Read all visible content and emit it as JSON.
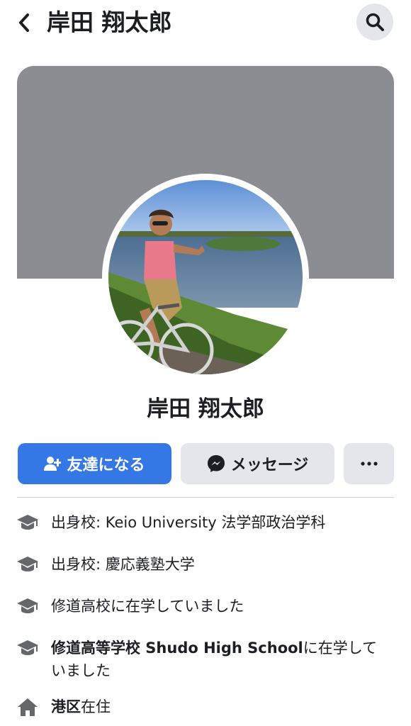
{
  "header": {
    "title": "岸田 翔太郎"
  },
  "profile": {
    "name": "岸田 翔太郎"
  },
  "actions": {
    "add_friend_label": "友達になる",
    "message_label": "メッセージ",
    "more_label": "···"
  },
  "info": [
    {
      "icon": "graduation-cap-icon",
      "text": "出身校: Keio University 法学部政治学科"
    },
    {
      "icon": "graduation-cap-icon",
      "text": "出身校: 慶応義塾大学"
    },
    {
      "icon": "graduation-cap-icon",
      "text": "修道高校に在学していました"
    },
    {
      "icon": "graduation-cap-icon",
      "bold": "修道高等学校 Shudo High School",
      "rest": "に在学していました"
    },
    {
      "icon": "home-icon",
      "bold": "港区",
      "rest": "在住"
    }
  ],
  "colors": {
    "primary": "#3578e5",
    "secondary_bg": "#e4e6eb",
    "cover": "#8a8d91",
    "text": "#1c1e21",
    "icon": "#65676b"
  }
}
